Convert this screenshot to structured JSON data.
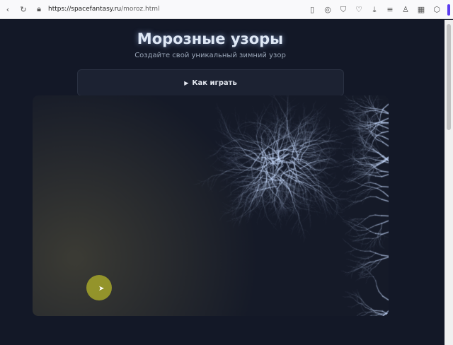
{
  "browser": {
    "url_host": "https://spacefantasy.ru",
    "url_path": "/moroz.html"
  },
  "page": {
    "title": "Морозные узоры",
    "subtitle": "Создайте свой уникальный зимний узор",
    "how_to_play": "Как играть",
    "how_icon": "▶"
  },
  "colors": {
    "background": "#131827",
    "frost": "#cfe0ff"
  }
}
